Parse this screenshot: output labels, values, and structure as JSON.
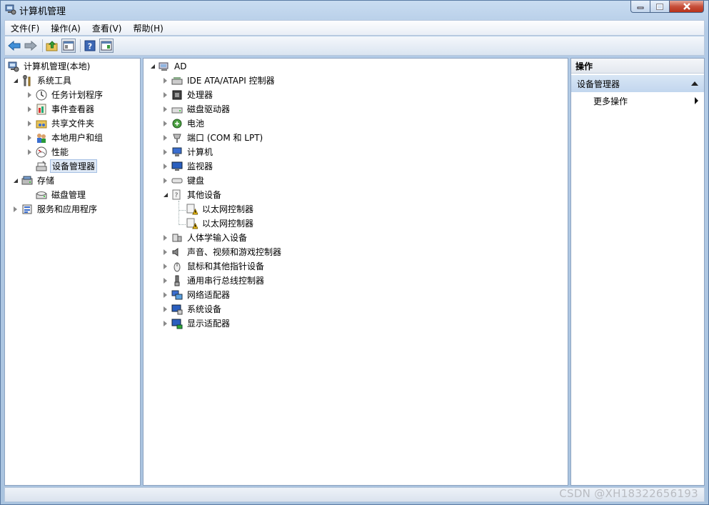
{
  "window": {
    "title": "计算机管理"
  },
  "menu": [
    "文件(F)",
    "操作(A)",
    "查看(V)",
    "帮助(H)"
  ],
  "left_tree": {
    "root": "计算机管理(本地)",
    "system_tools": "系统工具",
    "items": [
      "任务计划程序",
      "事件查看器",
      "共享文件夹",
      "本地用户和组",
      "性能",
      "设备管理器"
    ],
    "storage": "存储",
    "disk_mgmt": "磁盘管理",
    "services": "服务和应用程序"
  },
  "device_tree": {
    "root": "AD",
    "categories": [
      "IDE ATA/ATAPI 控制器",
      "处理器",
      "磁盘驱动器",
      "电池",
      "端口 (COM 和 LPT)",
      "计算机",
      "监视器",
      "键盘",
      "其他设备"
    ],
    "other_children": [
      "以太网控制器",
      "以太网控制器"
    ],
    "categories_after": [
      "人体学输入设备",
      "声音、视频和游戏控制器",
      "鼠标和其他指针设备",
      "通用串行总线控制器",
      "网络适配器",
      "系统设备",
      "显示适配器"
    ]
  },
  "actions": {
    "header": "操作",
    "section": "设备管理器",
    "more": "更多操作"
  },
  "watermark": "CSDN @XH18322656193"
}
